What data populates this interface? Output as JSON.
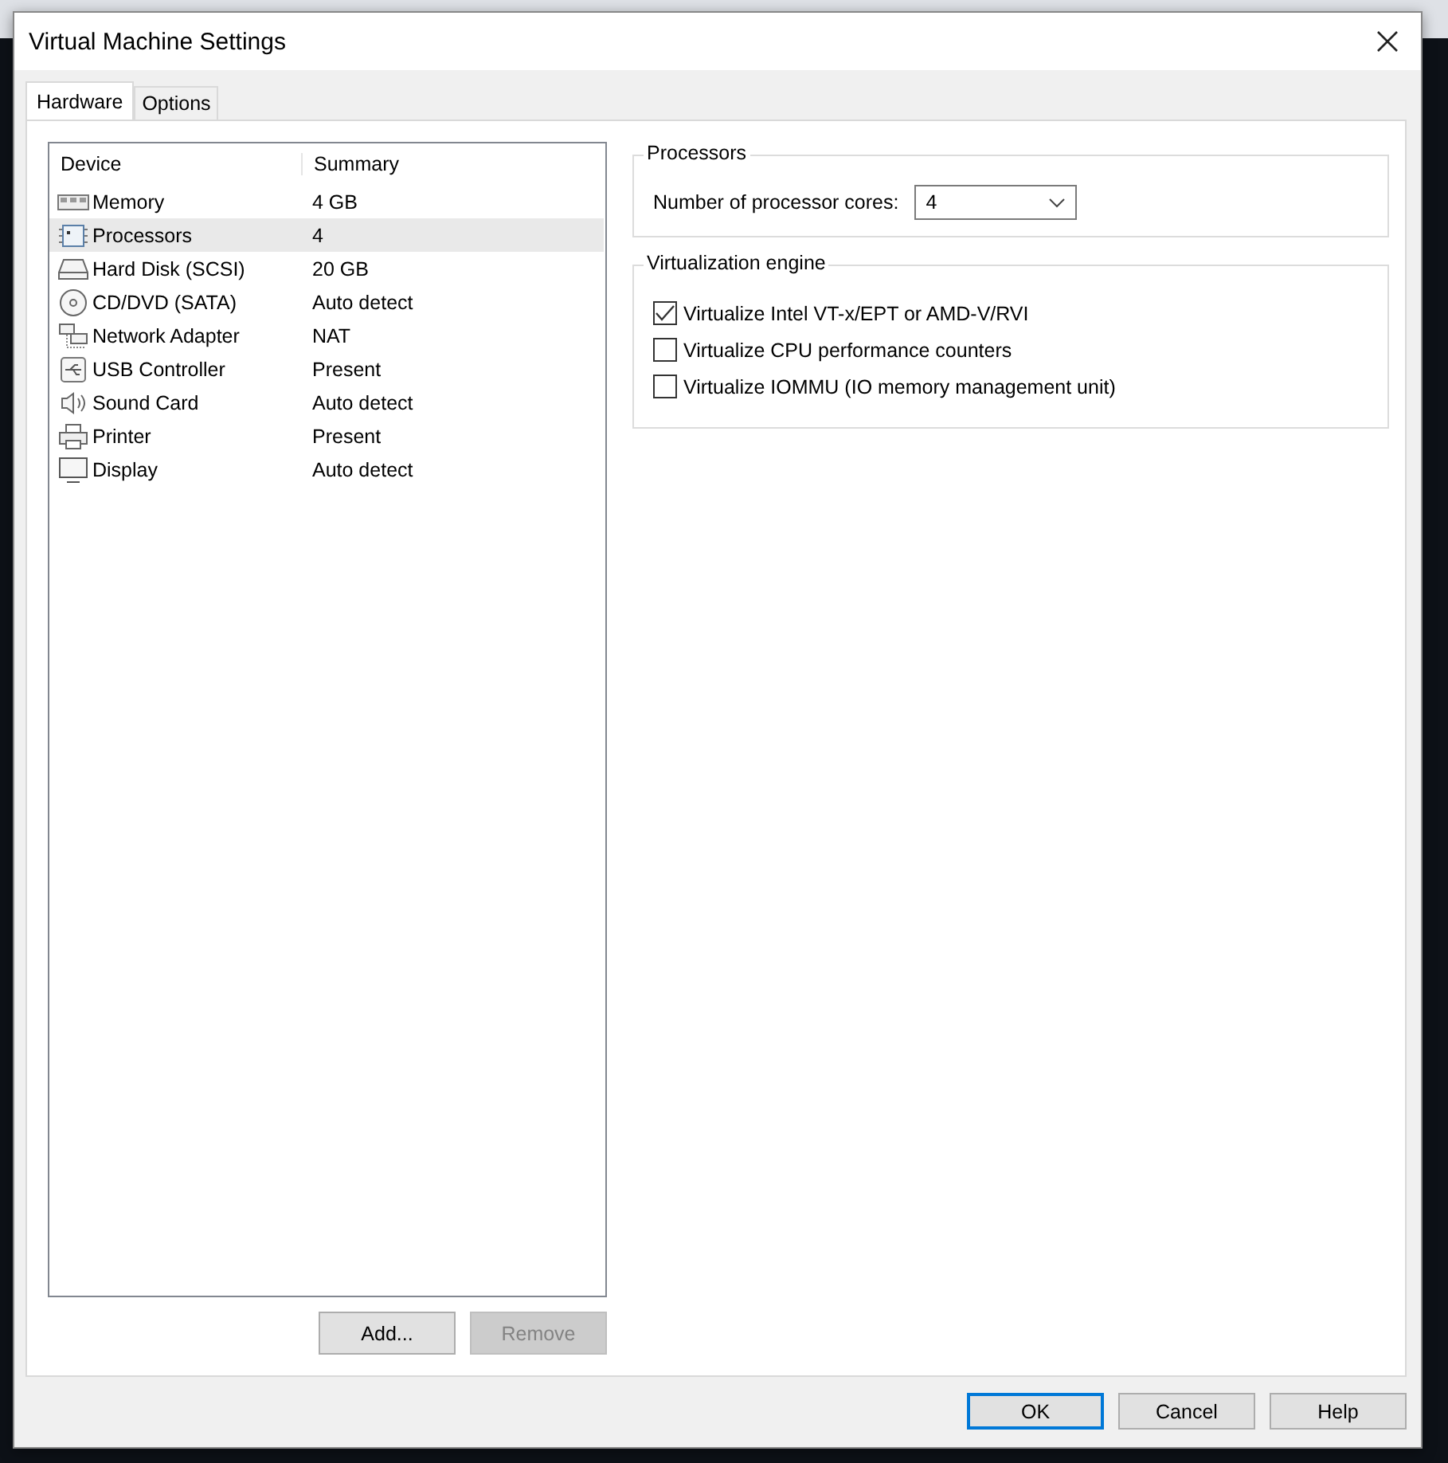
{
  "window": {
    "title": "Virtual Machine Settings"
  },
  "tabs": [
    {
      "label": "Hardware",
      "selected": true
    },
    {
      "label": "Options",
      "selected": false
    }
  ],
  "device_table": {
    "columns": [
      "Device",
      "Summary"
    ],
    "rows": [
      {
        "kind": "memory",
        "device": "Memory",
        "summary": "4 GB",
        "selected": false
      },
      {
        "kind": "processor",
        "device": "Processors",
        "summary": "4",
        "selected": true
      },
      {
        "kind": "disk",
        "device": "Hard Disk (SCSI)",
        "summary": "20 GB",
        "selected": false
      },
      {
        "kind": "cd",
        "device": "CD/DVD (SATA)",
        "summary": "Auto detect",
        "selected": false
      },
      {
        "kind": "network",
        "device": "Network Adapter",
        "summary": "NAT",
        "selected": false
      },
      {
        "kind": "usb",
        "device": "USB Controller",
        "summary": "Present",
        "selected": false
      },
      {
        "kind": "sound",
        "device": "Sound Card",
        "summary": "Auto detect",
        "selected": false
      },
      {
        "kind": "printer",
        "device": "Printer",
        "summary": "Present",
        "selected": false
      },
      {
        "kind": "display",
        "device": "Display",
        "summary": "Auto detect",
        "selected": false
      }
    ]
  },
  "device_buttons": [
    {
      "label": "Add...",
      "disabled": false
    },
    {
      "label": "Remove",
      "disabled": true
    }
  ],
  "processors": {
    "title": "Processors",
    "cores_label": "Number of processor cores:",
    "cores_value": "4"
  },
  "virtualization": {
    "title": "Virtualization engine",
    "options": [
      {
        "label": "Virtualize Intel VT-x/EPT or AMD-V/RVI",
        "checked": true
      },
      {
        "label": "Virtualize CPU performance counters",
        "checked": false
      },
      {
        "label": "Virtualize IOMMU (IO memory management unit)",
        "checked": false
      }
    ]
  },
  "buttons": [
    {
      "label": "OK",
      "default": true
    },
    {
      "label": "Cancel",
      "default": false
    },
    {
      "label": "Help",
      "default": false
    }
  ]
}
